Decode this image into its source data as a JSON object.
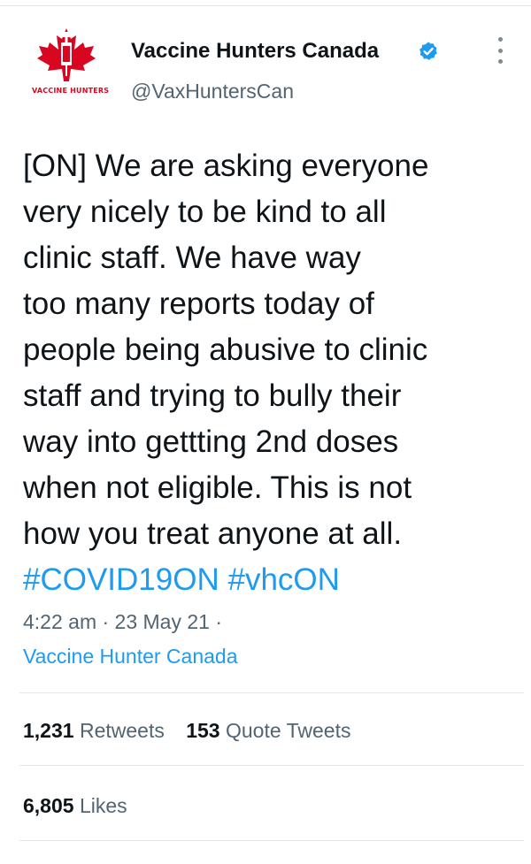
{
  "tweet": {
    "author": {
      "display_name": "Vaccine Hunters Canada",
      "handle": "@VaxHuntersCan",
      "verified": true,
      "avatar": {
        "icon": "maple-leaf-syringe-logo",
        "caption": "VACCINE HUNTERS",
        "color": "#d80621"
      }
    },
    "text_lines": [
      "[ON] We are asking everyone",
      "very nicely to be kind to all",
      "clinic staff. We have way",
      "too many reports today of",
      "people being abusive to clinic",
      "staff and trying to bully their",
      "way into gettting 2nd doses",
      "when not eligible. This is not",
      "how you treat anyone at all."
    ],
    "hashtags": [
      "#COVID19ON",
      "#vhcON"
    ],
    "timestamp": "4:22 am · 23 May 21 ·",
    "source": "Vaccine Hunter Canada",
    "stats": {
      "retweets": {
        "count": "1,231",
        "label": "Retweets"
      },
      "quote_tweets": {
        "count": "153",
        "label": "Quote Tweets"
      },
      "likes": {
        "count": "6,805",
        "label": "Likes"
      }
    }
  },
  "icons": {
    "verified": "verified-badge-icon",
    "more": "more-vertical-icon"
  },
  "colors": {
    "link": "#1d9bf0",
    "secondary_text": "#536471",
    "primary_text": "#0f1419",
    "brand_red": "#d80621",
    "divider": "#e6e9ea"
  }
}
